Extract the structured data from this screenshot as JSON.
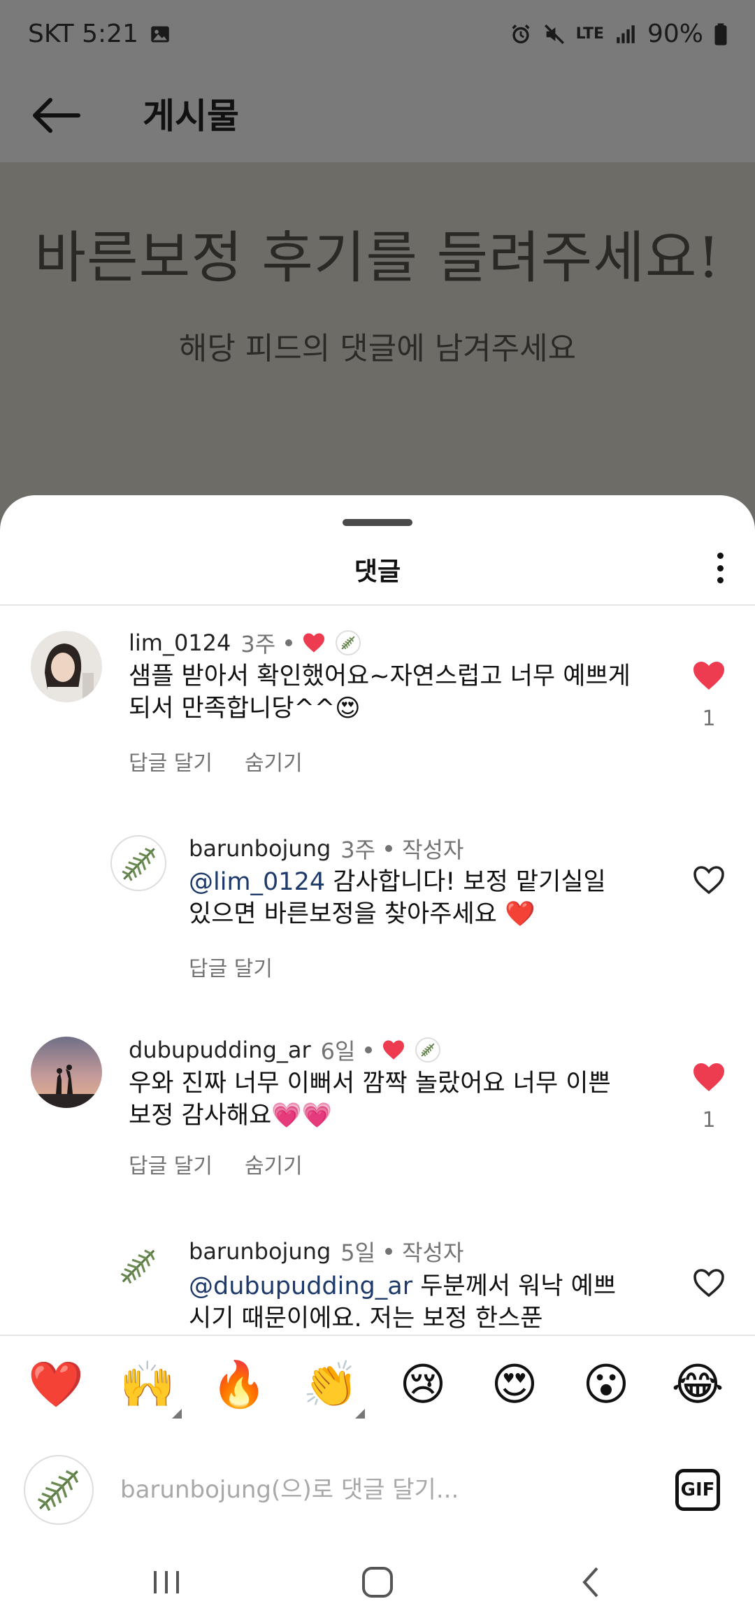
{
  "status_bar": {
    "carrier_time": "SKT 5:21",
    "network": "LTE",
    "battery": "90%"
  },
  "header": {
    "title": "게시물"
  },
  "post": {
    "title": "바른보정 후기를 들려주세요!",
    "subtitle": "해당 피드의 댓글에 남겨주세요"
  },
  "sheet": {
    "title": "댓글"
  },
  "comments": [
    {
      "username": "lim_0124",
      "time": "3주",
      "text": "샘플 받아서 확인했어요~자연스럽고 너무 예쁘게 되서 만족합니당^^😍",
      "reply_label": "답글 달기",
      "hide_label": "숨기기",
      "likes": "1"
    },
    {
      "username": "barunbojung",
      "time": "3주",
      "author_label": "작성자",
      "mention": "@lim_0124",
      "text": " 감사합니다! 보정 맡기실일 있으면 바른보정을 찾아주세요 ❤️",
      "reply_label": "답글 달기"
    },
    {
      "username": "dubupudding_ar",
      "time": "6일",
      "text": "우와 진짜 너무 이뻐서 깜짝 놀랐어요 너무 이쁜 보정 감사해요💗💗",
      "reply_label": "답글 달기",
      "hide_label": "숨기기",
      "likes": "1"
    },
    {
      "username": "barunbojung",
      "time": "5일",
      "author_label": "작성자",
      "mention": "@dubupudding_ar",
      "text": " 두분께서 워낙 예쁘시기 때문이에요. 저는 보정 한스푼"
    }
  ],
  "reactions": [
    "❤️",
    "🙌",
    "🔥",
    "👏",
    "😢",
    "😍",
    "😮",
    "😂"
  ],
  "composer": {
    "placeholder": "barunbojung(으)로 댓글 달기...",
    "gif_label": "GIF"
  },
  "colors": {
    "like_red": "#ed3b4f",
    "muted_text": "#737373",
    "mention": "#1e3a6b"
  }
}
